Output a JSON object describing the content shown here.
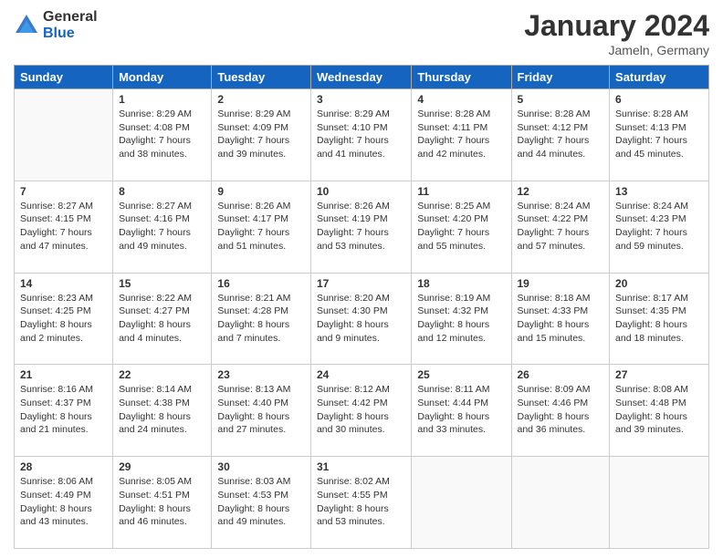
{
  "logo": {
    "general": "General",
    "blue": "Blue"
  },
  "header": {
    "title": "January 2024",
    "subtitle": "Jameln, Germany"
  },
  "weekdays": [
    "Sunday",
    "Monday",
    "Tuesday",
    "Wednesday",
    "Thursday",
    "Friday",
    "Saturday"
  ],
  "weeks": [
    [
      {
        "day": null,
        "sunrise": null,
        "sunset": null,
        "daylight": null
      },
      {
        "day": "1",
        "sunrise": "Sunrise: 8:29 AM",
        "sunset": "Sunset: 4:08 PM",
        "daylight": "Daylight: 7 hours and 38 minutes."
      },
      {
        "day": "2",
        "sunrise": "Sunrise: 8:29 AM",
        "sunset": "Sunset: 4:09 PM",
        "daylight": "Daylight: 7 hours and 39 minutes."
      },
      {
        "day": "3",
        "sunrise": "Sunrise: 8:29 AM",
        "sunset": "Sunset: 4:10 PM",
        "daylight": "Daylight: 7 hours and 41 minutes."
      },
      {
        "day": "4",
        "sunrise": "Sunrise: 8:28 AM",
        "sunset": "Sunset: 4:11 PM",
        "daylight": "Daylight: 7 hours and 42 minutes."
      },
      {
        "day": "5",
        "sunrise": "Sunrise: 8:28 AM",
        "sunset": "Sunset: 4:12 PM",
        "daylight": "Daylight: 7 hours and 44 minutes."
      },
      {
        "day": "6",
        "sunrise": "Sunrise: 8:28 AM",
        "sunset": "Sunset: 4:13 PM",
        "daylight": "Daylight: 7 hours and 45 minutes."
      }
    ],
    [
      {
        "day": "7",
        "sunrise": "Sunrise: 8:27 AM",
        "sunset": "Sunset: 4:15 PM",
        "daylight": "Daylight: 7 hours and 47 minutes."
      },
      {
        "day": "8",
        "sunrise": "Sunrise: 8:27 AM",
        "sunset": "Sunset: 4:16 PM",
        "daylight": "Daylight: 7 hours and 49 minutes."
      },
      {
        "day": "9",
        "sunrise": "Sunrise: 8:26 AM",
        "sunset": "Sunset: 4:17 PM",
        "daylight": "Daylight: 7 hours and 51 minutes."
      },
      {
        "day": "10",
        "sunrise": "Sunrise: 8:26 AM",
        "sunset": "Sunset: 4:19 PM",
        "daylight": "Daylight: 7 hours and 53 minutes."
      },
      {
        "day": "11",
        "sunrise": "Sunrise: 8:25 AM",
        "sunset": "Sunset: 4:20 PM",
        "daylight": "Daylight: 7 hours and 55 minutes."
      },
      {
        "day": "12",
        "sunrise": "Sunrise: 8:24 AM",
        "sunset": "Sunset: 4:22 PM",
        "daylight": "Daylight: 7 hours and 57 minutes."
      },
      {
        "day": "13",
        "sunrise": "Sunrise: 8:24 AM",
        "sunset": "Sunset: 4:23 PM",
        "daylight": "Daylight: 7 hours and 59 minutes."
      }
    ],
    [
      {
        "day": "14",
        "sunrise": "Sunrise: 8:23 AM",
        "sunset": "Sunset: 4:25 PM",
        "daylight": "Daylight: 8 hours and 2 minutes."
      },
      {
        "day": "15",
        "sunrise": "Sunrise: 8:22 AM",
        "sunset": "Sunset: 4:27 PM",
        "daylight": "Daylight: 8 hours and 4 minutes."
      },
      {
        "day": "16",
        "sunrise": "Sunrise: 8:21 AM",
        "sunset": "Sunset: 4:28 PM",
        "daylight": "Daylight: 8 hours and 7 minutes."
      },
      {
        "day": "17",
        "sunrise": "Sunrise: 8:20 AM",
        "sunset": "Sunset: 4:30 PM",
        "daylight": "Daylight: 8 hours and 9 minutes."
      },
      {
        "day": "18",
        "sunrise": "Sunrise: 8:19 AM",
        "sunset": "Sunset: 4:32 PM",
        "daylight": "Daylight: 8 hours and 12 minutes."
      },
      {
        "day": "19",
        "sunrise": "Sunrise: 8:18 AM",
        "sunset": "Sunset: 4:33 PM",
        "daylight": "Daylight: 8 hours and 15 minutes."
      },
      {
        "day": "20",
        "sunrise": "Sunrise: 8:17 AM",
        "sunset": "Sunset: 4:35 PM",
        "daylight": "Daylight: 8 hours and 18 minutes."
      }
    ],
    [
      {
        "day": "21",
        "sunrise": "Sunrise: 8:16 AM",
        "sunset": "Sunset: 4:37 PM",
        "daylight": "Daylight: 8 hours and 21 minutes."
      },
      {
        "day": "22",
        "sunrise": "Sunrise: 8:14 AM",
        "sunset": "Sunset: 4:38 PM",
        "daylight": "Daylight: 8 hours and 24 minutes."
      },
      {
        "day": "23",
        "sunrise": "Sunrise: 8:13 AM",
        "sunset": "Sunset: 4:40 PM",
        "daylight": "Daylight: 8 hours and 27 minutes."
      },
      {
        "day": "24",
        "sunrise": "Sunrise: 8:12 AM",
        "sunset": "Sunset: 4:42 PM",
        "daylight": "Daylight: 8 hours and 30 minutes."
      },
      {
        "day": "25",
        "sunrise": "Sunrise: 8:11 AM",
        "sunset": "Sunset: 4:44 PM",
        "daylight": "Daylight: 8 hours and 33 minutes."
      },
      {
        "day": "26",
        "sunrise": "Sunrise: 8:09 AM",
        "sunset": "Sunset: 4:46 PM",
        "daylight": "Daylight: 8 hours and 36 minutes."
      },
      {
        "day": "27",
        "sunrise": "Sunrise: 8:08 AM",
        "sunset": "Sunset: 4:48 PM",
        "daylight": "Daylight: 8 hours and 39 minutes."
      }
    ],
    [
      {
        "day": "28",
        "sunrise": "Sunrise: 8:06 AM",
        "sunset": "Sunset: 4:49 PM",
        "daylight": "Daylight: 8 hours and 43 minutes."
      },
      {
        "day": "29",
        "sunrise": "Sunrise: 8:05 AM",
        "sunset": "Sunset: 4:51 PM",
        "daylight": "Daylight: 8 hours and 46 minutes."
      },
      {
        "day": "30",
        "sunrise": "Sunrise: 8:03 AM",
        "sunset": "Sunset: 4:53 PM",
        "daylight": "Daylight: 8 hours and 49 minutes."
      },
      {
        "day": "31",
        "sunrise": "Sunrise: 8:02 AM",
        "sunset": "Sunset: 4:55 PM",
        "daylight": "Daylight: 8 hours and 53 minutes."
      },
      {
        "day": null,
        "sunrise": null,
        "sunset": null,
        "daylight": null
      },
      {
        "day": null,
        "sunrise": null,
        "sunset": null,
        "daylight": null
      },
      {
        "day": null,
        "sunrise": null,
        "sunset": null,
        "daylight": null
      }
    ]
  ]
}
